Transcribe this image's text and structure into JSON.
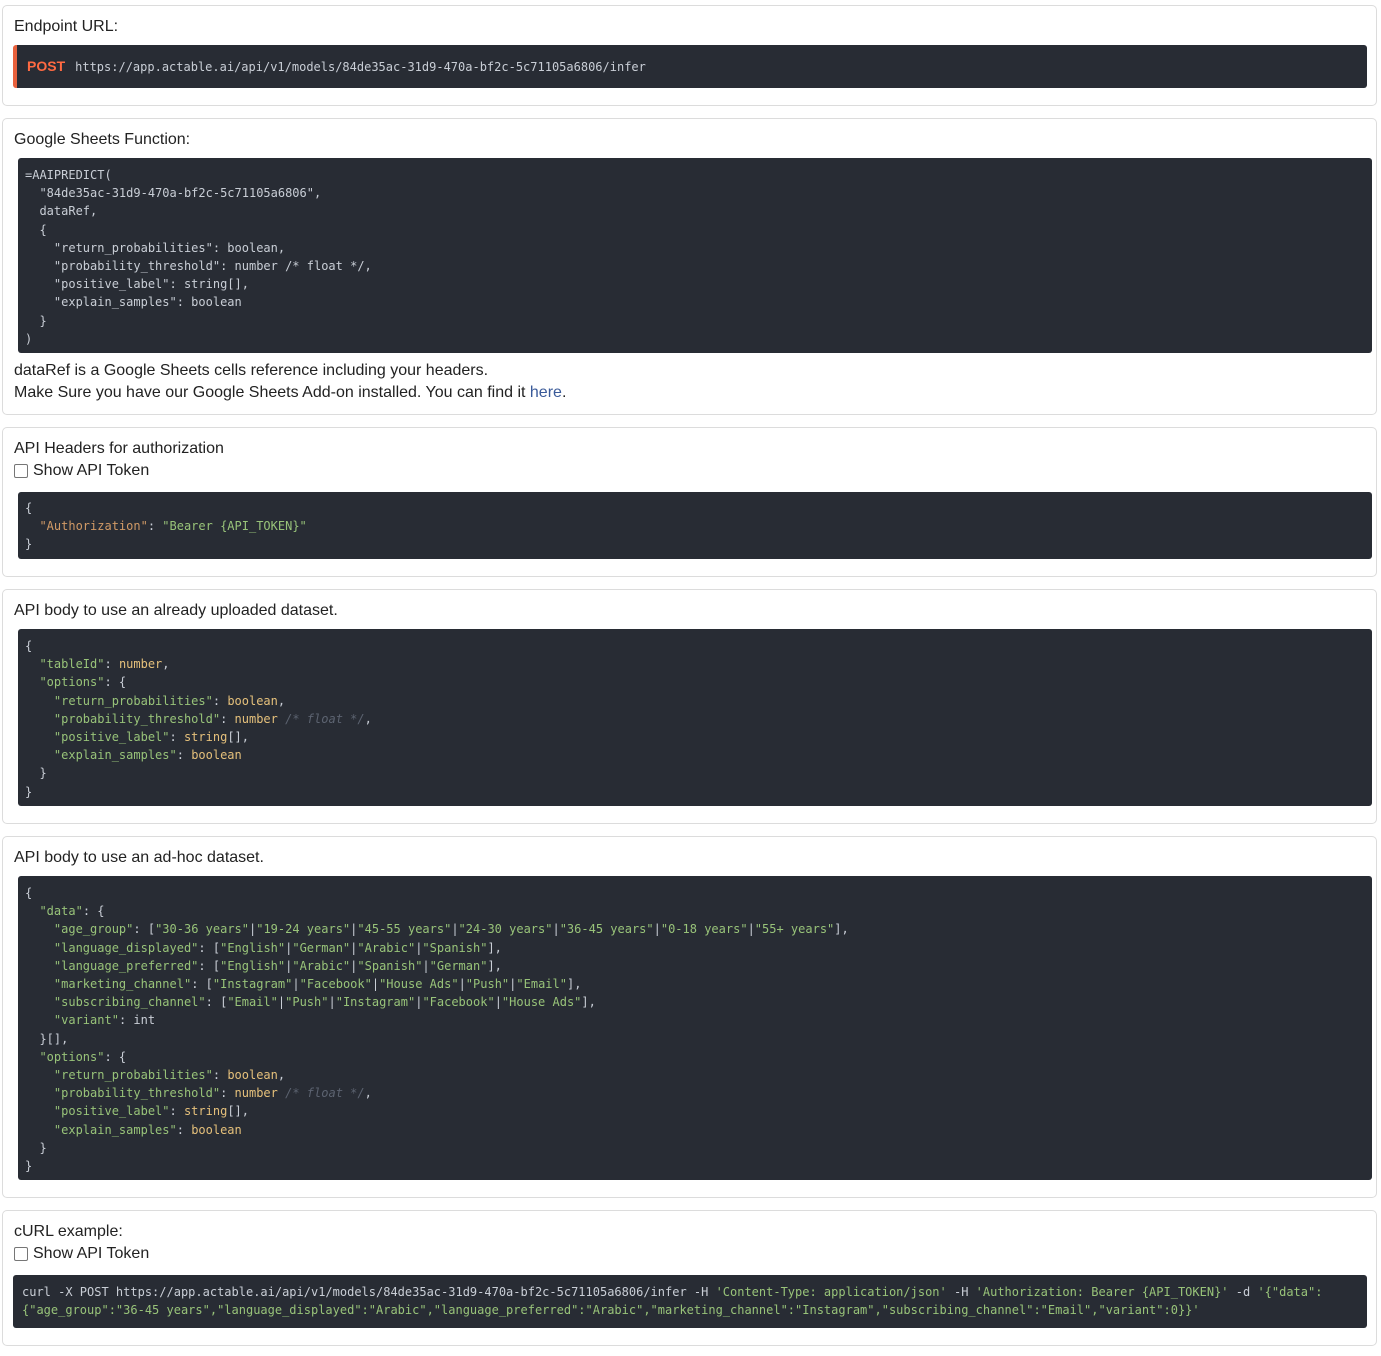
{
  "endpoint": {
    "title": "Endpoint URL:",
    "method": "POST",
    "url": "https://app.actable.ai/api/v1/models/84de35ac-31d9-470a-bf2c-5c71105a6806/infer"
  },
  "sheets": {
    "title": "Google Sheets Function:",
    "code_lines": [
      "=AAIPREDICT(",
      "  \"84de35ac-31d9-470a-bf2c-5c71105a6806\",",
      "  dataRef,",
      "  {",
      "    \"return_probabilities\": boolean,",
      "    \"probability_threshold\": number /* float */,",
      "    \"positive_label\": string[],",
      "    \"explain_samples\": boolean",
      "  }",
      ")"
    ],
    "note_line1": "dataRef is a Google Sheets cells reference including your headers.",
    "note_line2_prefix": "Make Sure you have our Google Sheets Add-on installed. You can find it ",
    "note_link": "here",
    "note_suffix": "."
  },
  "headers": {
    "title": "API Headers for authorization",
    "show_token_label": "Show API Token",
    "auth_key": "\"Authorization\"",
    "auth_value": "\"Bearer {API_TOKEN}\""
  },
  "uploaded": {
    "title": "API body to use an already uploaded dataset."
  },
  "adhoc": {
    "title": "API body to use an ad-hoc dataset."
  },
  "curl": {
    "title": "cURL example:",
    "show_token_label": "Show API Token",
    "line1_plain": "curl -X POST https://app.actable.ai/api/v1/models/84de35ac-31d9-470a-bf2c-5c71105a6806/infer -H ",
    "line1_ct": "'Content-Type: application/json'",
    "line1_mid": " -H ",
    "line1_auth": "'Authorization: Bearer {API_TOKEN}'",
    "line1_d": " -d ",
    "line1_data": "'{\"data\":",
    "line2": "{\"age_group\":\"36-45 years\",\"language_displayed\":\"Arabic\",\"language_preferred\":\"Arabic\",\"marketing_channel\":\"Instagram\",\"subscribing_channel\":\"Email\",\"variant\":0}}'"
  }
}
